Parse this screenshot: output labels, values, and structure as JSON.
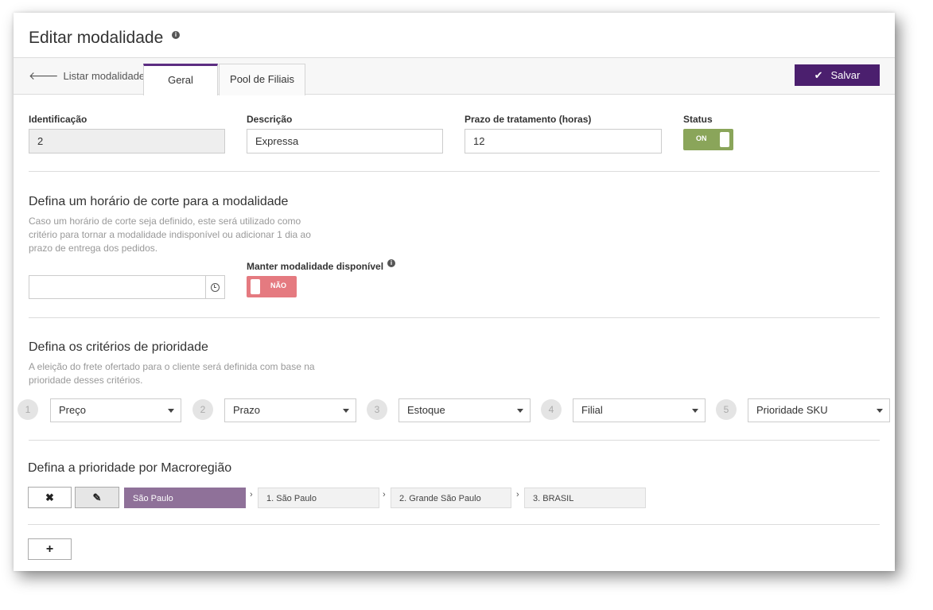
{
  "header": {
    "title": "Editar modalidade",
    "info_icon": "info-circle-icon"
  },
  "tabs_bar": {
    "back_label": "Listar modalidades",
    "back_icon": "arrow-left-icon",
    "tabs": [
      {
        "label": "Geral",
        "active": true
      },
      {
        "label": "Pool de Filiais",
        "active": false
      }
    ],
    "save_label": "Salvar",
    "save_icon": "check-icon",
    "accent_color": "#4b1f6e"
  },
  "form": {
    "identificacao": {
      "label": "Identificação",
      "value": "2"
    },
    "descricao": {
      "label": "Descrição",
      "value": "Expressa"
    },
    "prazo": {
      "label": "Prazo de tratamento (horas)",
      "value": "12"
    },
    "status": {
      "label": "Status",
      "toggle_text": "ON",
      "on": true,
      "color": "#8aa55a"
    }
  },
  "cutoff": {
    "title": "Defina um horário de corte para a modalidade",
    "description": "Caso um horário de corte seja definido, este será utilizado como critério para tornar a modalidade indisponível ou adicionar 1 dia ao prazo de entrega dos pedidos.",
    "time_value": "",
    "time_icon": "clock-icon",
    "keep_label": "Manter modalidade disponível",
    "keep_toggle_text": "NÃO",
    "keep_on": false,
    "keep_color": "#e57a80"
  },
  "priority": {
    "title": "Defina os critérios de prioridade",
    "description": "A eleição do frete ofertado para o cliente será definida com base na prioridade desses critérios.",
    "criteria": [
      {
        "num": "1",
        "value": "Preço"
      },
      {
        "num": "2",
        "value": "Prazo"
      },
      {
        "num": "3",
        "value": "Estoque"
      },
      {
        "num": "4",
        "value": "Filial"
      },
      {
        "num": "5",
        "value": "Prioridade SKU"
      }
    ]
  },
  "macro": {
    "title": "Defina a prioridade por Macroregião",
    "remove_label": "✖",
    "edit_label": "✎",
    "region": "São Paulo",
    "region_color": "#8f7199",
    "items": [
      "1. São Paulo",
      "2. Grande São Paulo",
      "3. BRASIL"
    ],
    "add_label": "+"
  }
}
